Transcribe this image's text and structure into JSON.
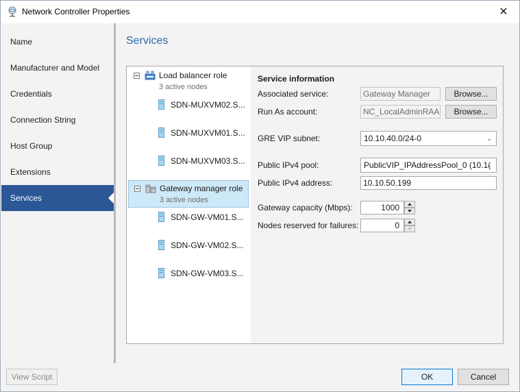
{
  "window": {
    "title": "Network Controller Properties"
  },
  "nav": {
    "items": [
      {
        "label": "Name"
      },
      {
        "label": "Manufacturer and Model"
      },
      {
        "label": "Credentials"
      },
      {
        "label": "Connection String"
      },
      {
        "label": "Host Group"
      },
      {
        "label": "Extensions"
      },
      {
        "label": "Services",
        "selected": true
      }
    ]
  },
  "main": {
    "title": "Services",
    "tree": {
      "roles": [
        {
          "label": "Load balancer role",
          "sub": "3 active nodes",
          "nodes": [
            "SDN-MUXVM02.S...",
            "SDN-MUXVM01.S...",
            "SDN-MUXVM03.S..."
          ]
        },
        {
          "label": "Gateway manager role",
          "sub": "3 active nodes",
          "selected": true,
          "nodes": [
            "SDN-GW-VM01.S...",
            "SDN-GW-VM02.S...",
            "SDN-GW-VM03.S..."
          ]
        }
      ]
    },
    "service_info": {
      "title": "Service information",
      "associated_service": {
        "label": "Associated service:",
        "value": "Gateway Manager",
        "button": "Browse..."
      },
      "run_as": {
        "label": "Run As account:",
        "value": "NC_LocalAdminRAA",
        "button": "Browse..."
      },
      "gre_vip": {
        "label": "GRE VIP subnet:",
        "value": "10.10.40.0/24-0"
      },
      "ipv4_pool": {
        "label": "Public IPv4 pool:",
        "value": "PublicVIP_IPAddressPool_0 (10.1("
      },
      "ipv4_address": {
        "label": "Public IPv4 address:",
        "value": "10.10.50.199"
      },
      "capacity": {
        "label": "Gateway capacity (Mbps):",
        "value": "1000"
      },
      "reserved": {
        "label": "Nodes reserved for failures:",
        "value": "0"
      }
    }
  },
  "footer": {
    "view_script": "View Script",
    "ok": "OK",
    "cancel": "Cancel"
  },
  "colors": {
    "accent": "#2b5797",
    "title": "#2b6aa8",
    "selection": "#cde8f7"
  }
}
